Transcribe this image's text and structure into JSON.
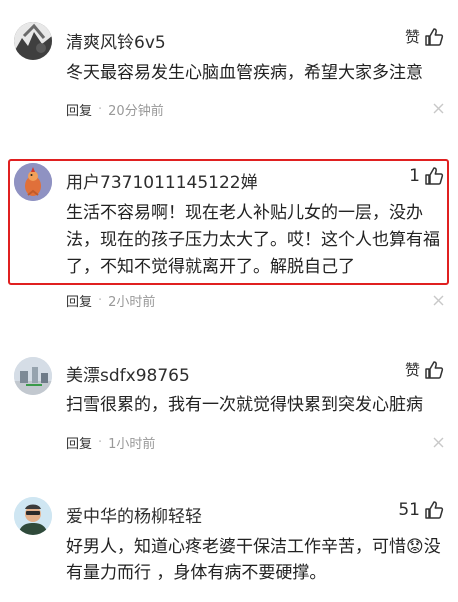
{
  "comments": [
    {
      "username": "清爽风铃6v5",
      "like_label": "赞",
      "like_count": "",
      "text": "冬天最容易发生心脑血管疾病，希望大家多注意",
      "reply_label": "回复",
      "dot": "·",
      "time": "20分钟前"
    },
    {
      "username": "用户7371011145122婵",
      "like_label": "",
      "like_count": "1",
      "text": "生活不容易啊！现在老人补贴儿女的一层，没办法，现在的孩子压力太大了。哎！这个人也算有福了，不知不觉得就离开了。解脱自己了",
      "reply_label": "回复",
      "dot": "·",
      "time": "2小时前"
    },
    {
      "username": "美漂sdfx98765",
      "like_label": "赞",
      "like_count": "",
      "text": "扫雪很累的，我有一次就觉得快累到突发心脏病",
      "reply_label": "回复",
      "dot": "·",
      "time": "1小时前"
    },
    {
      "username": "爱中华的杨柳轻轻",
      "like_label": "",
      "like_count": "51",
      "text": "好男人，知道心疼老婆干保洁工作辛苦，可惜😟没有量力而行 ，身体有病不要硬撑。",
      "reply_label": "",
      "dot": "",
      "time": ""
    }
  ],
  "icons": {
    "like": "thumbs-up-icon",
    "dismiss": "close-icon"
  },
  "colors": {
    "highlight_border": "#e02020",
    "time_text": "#999999",
    "avatar_2_bg": "#8f92c2"
  }
}
